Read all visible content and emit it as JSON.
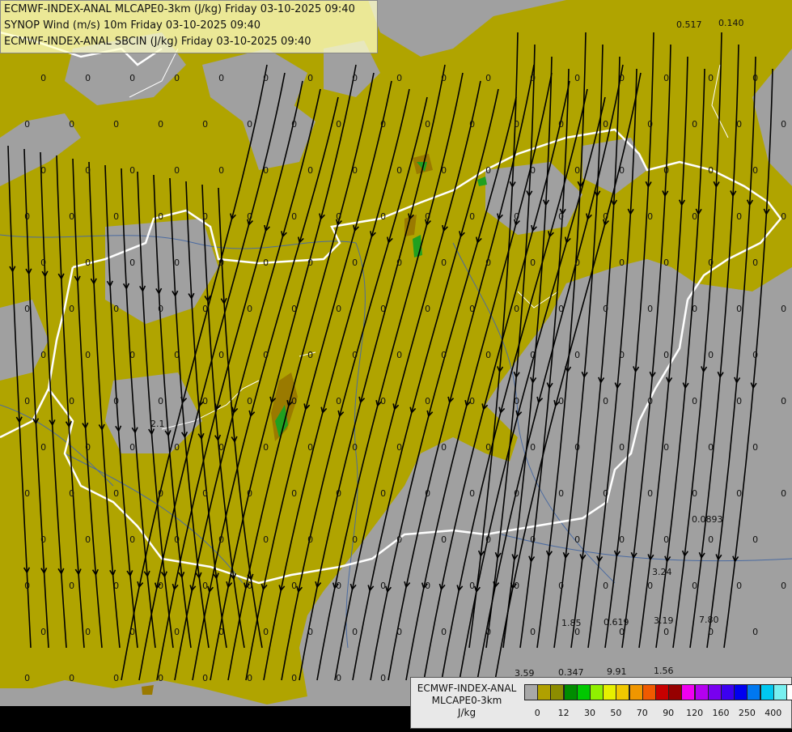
{
  "titles": {
    "line1": "ECMWF-INDEX-ANAL MLCAPE0-3km (J/kg) Friday 03-10-2025 09:40",
    "line2": "SYNOP Wind (m/s) 10m Friday 03-10-2025 09:40",
    "line3": "ECMWF-INDEX-ANAL SBCIN (J/kg) Friday 03-10-2025 09:40"
  },
  "colorbar": {
    "label_line1": "ECMWF-INDEX-ANAL",
    "label_line2": "MLCAPE0-3km",
    "label_line3": "J/kg",
    "swatches": [
      "#a8a8a8",
      "#b0a000",
      "#8c8c00",
      "#008c00",
      "#00c800",
      "#90f000",
      "#e6f000",
      "#f0c800",
      "#f09600",
      "#f05a00",
      "#c80000",
      "#960000",
      "#f000f0",
      "#b400f0",
      "#7800f0",
      "#3c00f0",
      "#0000f0",
      "#0078f0",
      "#00c8f0",
      "#78f0f0",
      "#ffffff"
    ],
    "ticks": [
      "0",
      "12",
      "30",
      "50",
      "70",
      "90",
      "120",
      "160",
      "250",
      "400"
    ]
  },
  "colors": {
    "background": "#a0a0a0",
    "cape_low": "#b0a400",
    "cape_mid": "#9a7a00",
    "cape_green": "#20a020",
    "border": "#ffffff",
    "rivers": "#4a6aa0",
    "streamlines": "#000000"
  },
  "cin_labels": [
    {
      "text": "0.517"
    },
    {
      "text": "0.140"
    },
    {
      "text": "2.1"
    },
    {
      "text": "0.0893"
    },
    {
      "text": "3.24"
    },
    {
      "text": "1.85"
    },
    {
      "text": "0.619"
    },
    {
      "text": "3.19"
    },
    {
      "text": "7.80"
    },
    {
      "text": "3.59"
    },
    {
      "text": "0.347"
    },
    {
      "text": "9.91"
    },
    {
      "text": "1.56"
    }
  ]
}
